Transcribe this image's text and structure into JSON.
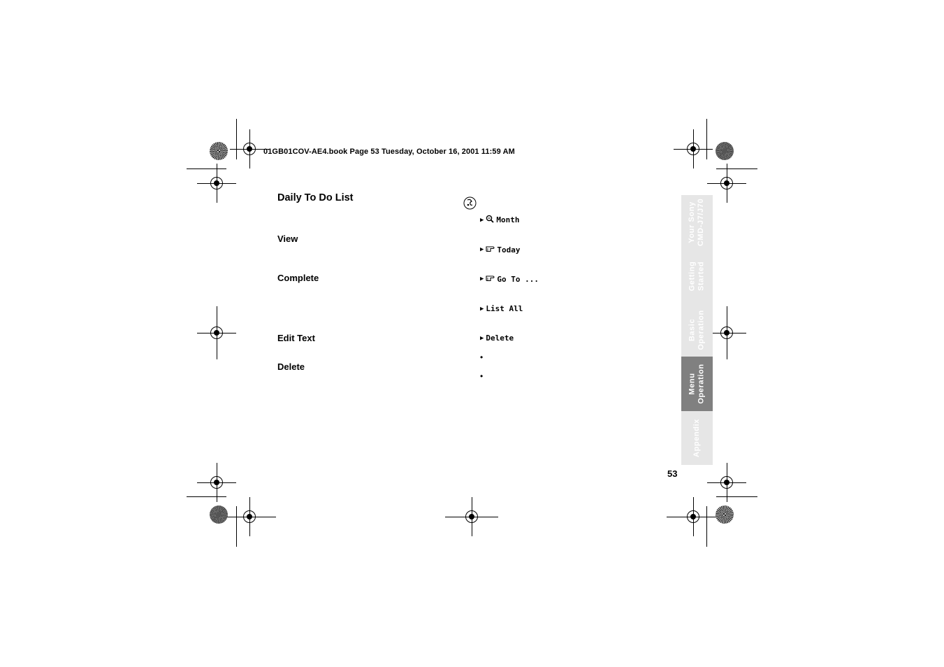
{
  "header": {
    "text": "01GB01COV-AE4.book  Page 53  Tuesday, October 16, 2001  11:59 AM"
  },
  "content": {
    "title": "Daily To Do List",
    "sections": [
      {
        "label": "View"
      },
      {
        "label": "Complete"
      },
      {
        "label": "Edit Text"
      },
      {
        "label": "Delete"
      }
    ],
    "menu_icon": "phone-menu-icon",
    "menu_items": [
      {
        "label": "Month",
        "icon": "magnifier-icon"
      },
      {
        "label": "Today",
        "icon": "hand-point-icon"
      },
      {
        "label": "Go To ...",
        "icon": "hand-point-icon"
      },
      {
        "label": "List All",
        "icon": ""
      },
      {
        "label": "Delete",
        "icon": ""
      }
    ],
    "bullets": [
      "•",
      "•"
    ]
  },
  "side_tabs": [
    {
      "label": "Your Sony\nCMD-J7/J70",
      "active": false
    },
    {
      "label": "Getting\nStarted",
      "active": false
    },
    {
      "label": "Basic\nOperation",
      "active": false
    },
    {
      "label": "Menu\nOperation",
      "active": true
    },
    {
      "label": "Appendix",
      "active": false
    }
  ],
  "page_number": "53",
  "colors": {
    "tab_inactive": "#e6e6e6",
    "tab_active": "#808080",
    "tab_text": "#ffffff"
  }
}
